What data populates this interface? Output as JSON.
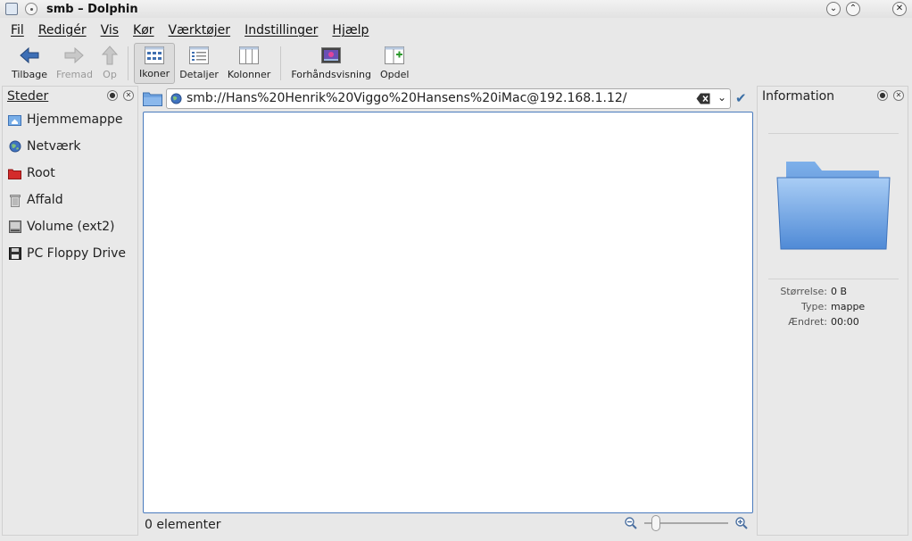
{
  "window": {
    "title": "smb – Dolphin"
  },
  "menu": [
    "Fil",
    "Redigér",
    "Vis",
    "Kør",
    "Værktøjer",
    "Indstillinger",
    "Hjælp"
  ],
  "toolbar": {
    "back": "Tilbage",
    "forward": "Fremad",
    "up": "Op",
    "icons": "Ikoner",
    "details": "Detaljer",
    "columns": "Kolonner",
    "preview": "Forhåndsvisning",
    "split": "Opdel"
  },
  "places": {
    "title": "Steder",
    "items": [
      {
        "label": "Hjemmemappe",
        "icon": "home-folder-icon"
      },
      {
        "label": "Netværk",
        "icon": "network-globe-icon"
      },
      {
        "label": "Root",
        "icon": "red-folder-icon"
      },
      {
        "label": "Affald",
        "icon": "trash-icon"
      },
      {
        "label": "Volume (ext2)",
        "icon": "hard-drive-icon"
      },
      {
        "label": "PC Floppy Drive",
        "icon": "floppy-icon"
      }
    ]
  },
  "location": {
    "url": "smb://Hans%20Henrik%20Viggo%20Hansens%20iMac@192.168.1.12/"
  },
  "status": {
    "text": "0 elementer",
    "zoom_level": 0.1
  },
  "info": {
    "title": "Information",
    "rows": [
      {
        "key": "Størrelse:",
        "value": "0 B"
      },
      {
        "key": "Type:",
        "value": "mappe"
      },
      {
        "key": "Ændret:",
        "value": "00:00"
      }
    ]
  },
  "colors": {
    "accent": "#4a7bbd",
    "folder": "#6fa3e0"
  }
}
